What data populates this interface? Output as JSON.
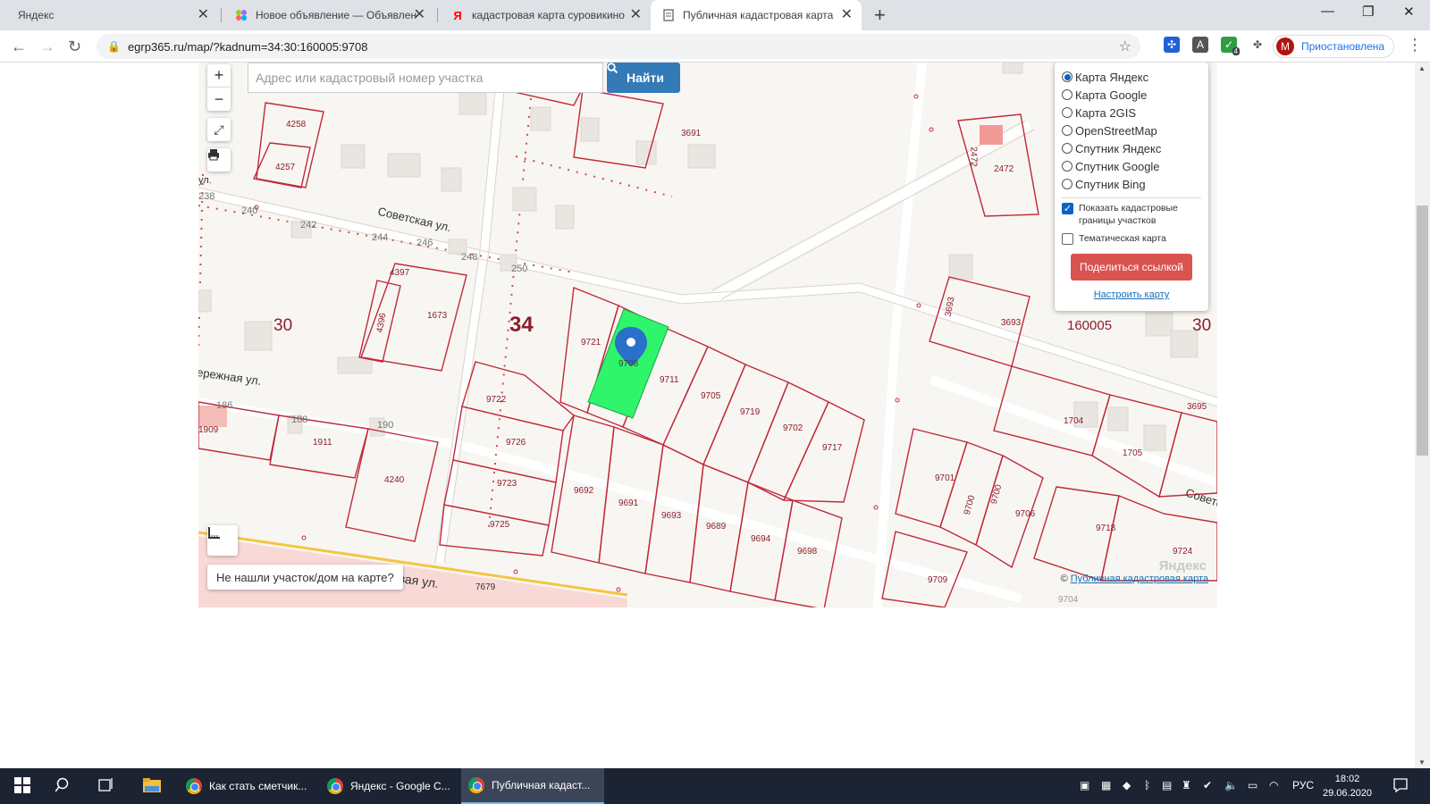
{
  "browser": {
    "tabs": [
      {
        "title": "Яндекс",
        "icon": "none",
        "active": false
      },
      {
        "title": "Новое объявление — Объявления",
        "icon": "avito-icon",
        "active": false
      },
      {
        "title": "кадастровая карта суровикино",
        "icon": "yandex-icon",
        "active": false
      },
      {
        "title": "Публичная кадастровая карта",
        "icon": "page-icon",
        "active": true
      }
    ],
    "url": "egrp365.ru/map/?kadnum=34:30:160005:9708",
    "profile_label": "Приостановлена",
    "profile_initial": "M",
    "ext_badge": "4"
  },
  "map": {
    "search_placeholder": "Адрес или кадастровый номер участка",
    "find_label": "Найти",
    "zoom_in": "+",
    "zoom_out": "−",
    "layers": [
      {
        "label": "Карта Яндекс",
        "selected": true
      },
      {
        "label": "Карта Google",
        "selected": false
      },
      {
        "label": "Карта 2GIS",
        "selected": false
      },
      {
        "label": "OpenStreetMap",
        "selected": false
      },
      {
        "label": "Спутник Яндекс",
        "selected": false
      },
      {
        "label": "Спутник Google",
        "selected": false
      },
      {
        "label": "Спутник Bing",
        "selected": false
      }
    ],
    "show_borders_label": "Показать кадастровые границы участков",
    "show_borders_checked": true,
    "thematic_label": "Тематическая карта",
    "thematic_checked": false,
    "share_label": "Поделиться ссылкой",
    "setup_label": "Настроить карту",
    "not_found_label": "Не нашли участок/дом на карте?",
    "copyright_prefix": "©",
    "copyright_link": "Публичная кадастровая карта",
    "yandex_logo": "Яндекс",
    "street_labels": [
      "Советская ул.",
      "Луговая ул.",
      "ережная ул.",
      "Совето"
    ],
    "quarter_labels": [
      "30",
      "34",
      "160005",
      "30"
    ],
    "parcel_labels": [
      "4258",
      "4257",
      "3691",
      "2472",
      "2472",
      "240",
      "242",
      "244",
      "246",
      "248",
      "250",
      "238",
      "4397",
      "1673",
      "4396",
      "9721",
      "9708",
      "9711",
      "9705",
      "9719",
      "9702",
      "9717",
      "9722",
      "9726",
      "9723",
      "9725",
      "9692",
      "9691",
      "9693",
      "9689",
      "9694",
      "9698",
      "186",
      "188",
      "190",
      "1909",
      "1911",
      "4240",
      "7679",
      "3693",
      "3693",
      "1704",
      "1705",
      "3695",
      "9701",
      "9700",
      "9700",
      "9706",
      "9718",
      "9724",
      "9709",
      "9704",
      "ул."
    ],
    "accent_colors": {
      "parcel_border": "#c0293b",
      "selected_parcel": "#2ff56a",
      "marker": "#2a6fc9"
    }
  },
  "taskbar": {
    "apps": [
      {
        "label": "Как стать сметчик...",
        "active": false
      },
      {
        "label": "Яндекс - Google C...",
        "active": false
      },
      {
        "label": "Публичная кадаст...",
        "active": true
      }
    ],
    "language": "РУС",
    "time": "18:02",
    "date": "29.06.2020"
  }
}
